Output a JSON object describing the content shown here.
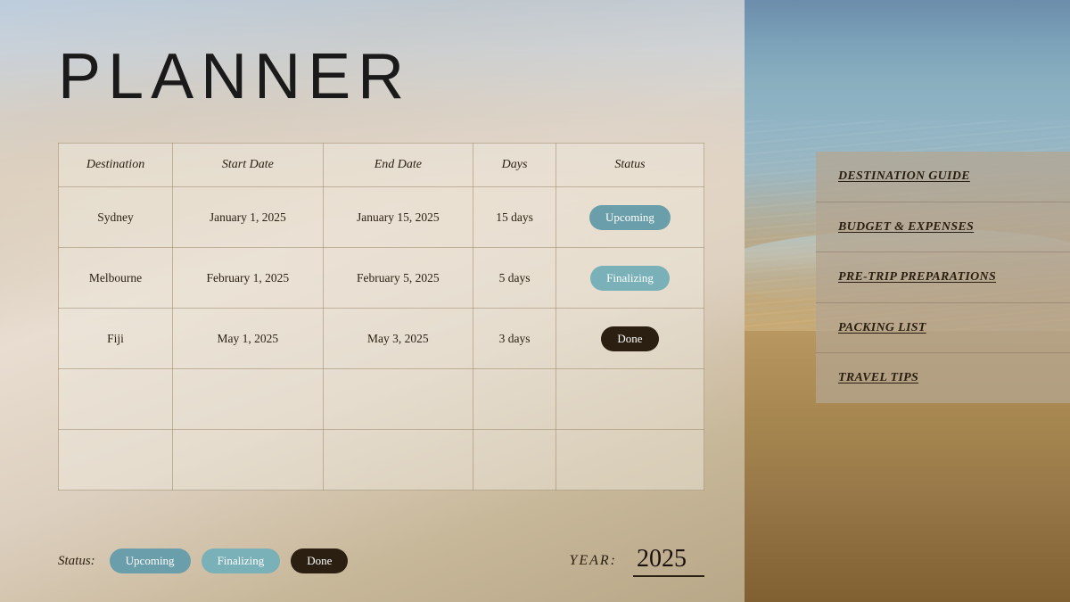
{
  "title": "PLANNER",
  "table": {
    "headers": [
      "Destination",
      "Start Date",
      "End Date",
      "Days",
      "Status"
    ],
    "rows": [
      {
        "destination": "Sydney",
        "start_date": "January 1, 2025",
        "end_date": "January 15, 2025",
        "days": "15 days",
        "status": "Upcoming",
        "status_type": "upcoming"
      },
      {
        "destination": "Melbourne",
        "start_date": "February 1, 2025",
        "end_date": "February 5, 2025",
        "days": "5 days",
        "status": "Finalizing",
        "status_type": "finalizing"
      },
      {
        "destination": "Fiji",
        "start_date": "May 1, 2025",
        "end_date": "May 3, 2025",
        "days": "3 days",
        "status": "Done",
        "status_type": "done"
      },
      {
        "destination": "",
        "start_date": "",
        "end_date": "",
        "days": "",
        "status": "",
        "status_type": ""
      },
      {
        "destination": "",
        "start_date": "",
        "end_date": "",
        "days": "",
        "status": "",
        "status_type": ""
      }
    ]
  },
  "footer": {
    "status_label": "Status:",
    "badges": {
      "upcoming": "Upcoming",
      "finalizing": "Finalizing",
      "done": "Done"
    },
    "year_label": "YEAR:",
    "year_value": "2025"
  },
  "nav": {
    "items": [
      {
        "id": "destination-guide",
        "label": "DESTINATION GUIDE"
      },
      {
        "id": "budget-expenses",
        "label": "BUDGET & EXPENSES"
      },
      {
        "id": "pre-trip-preparations",
        "label": "PRE-TRIP PREPARATIONS"
      },
      {
        "id": "packing-list",
        "label": "PACKING LIST"
      },
      {
        "id": "travel-tips",
        "label": "TRAVEL TIPS"
      }
    ]
  },
  "colors": {
    "upcoming": "#6a9eaa",
    "finalizing": "#7ab0b8",
    "done": "#2a1f10"
  }
}
